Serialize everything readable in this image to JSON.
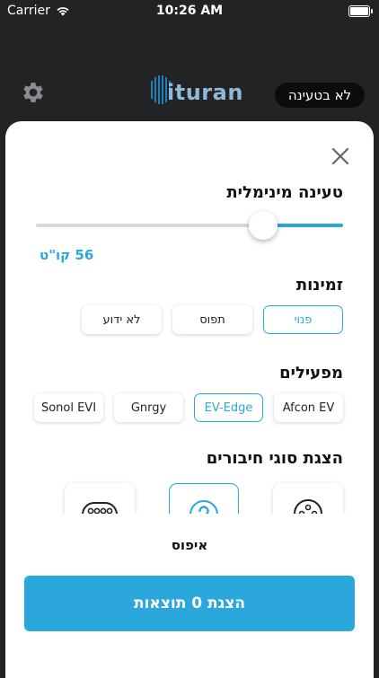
{
  "status_bar": {
    "carrier": "Carrier",
    "time": "10:26 AM"
  },
  "header": {
    "logo_text": "ituran",
    "charging_toggle": "לא בטעינה"
  },
  "filters": {
    "min_charge": {
      "title": "טעינה מינימלית",
      "value_label": "56 קו\"ט",
      "slider_fraction": 0.74
    },
    "availability": {
      "title": "זמינות",
      "options": [
        "פנוי",
        "תפוס",
        "לא ידוע"
      ],
      "selected": 0
    },
    "operators": {
      "title": "מפעילים",
      "options": [
        "Afcon EV",
        "EV-Edge",
        "Gnrgy",
        "Sonol EVI"
      ],
      "selected": 1
    },
    "connectors": {
      "title": "הצגת סוגי חיבורים",
      "icons": [
        "type2-connector-icon",
        "unknown-connector-icon",
        "ccs-connector-icon"
      ],
      "selected": 1
    }
  },
  "actions": {
    "reset": "איפוס",
    "show_results": "הצגת 0 תוצאות"
  },
  "colors": {
    "accent": "#2ba7de",
    "background": "#222325",
    "sheet": "#ffffff"
  }
}
